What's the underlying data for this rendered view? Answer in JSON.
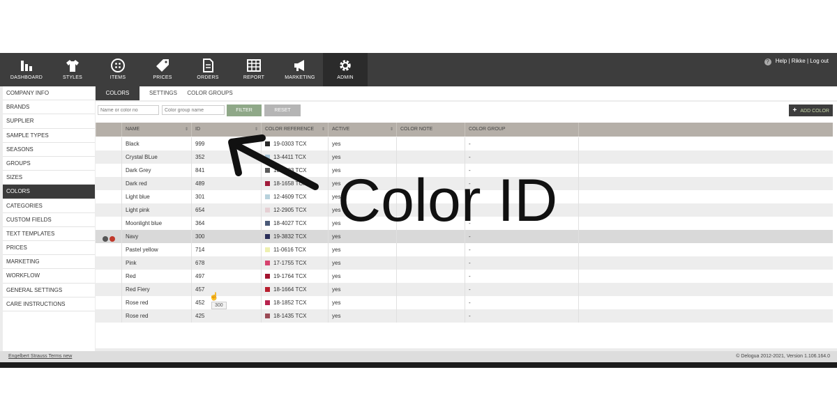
{
  "nav": {
    "items": [
      {
        "label": "DASHBOARD",
        "icon": "bar-chart-icon"
      },
      {
        "label": "STYLES",
        "icon": "shirt-icon"
      },
      {
        "label": "ITEMS",
        "icon": "button-icon"
      },
      {
        "label": "PRICES",
        "icon": "price-tag-icon"
      },
      {
        "label": "ORDERS",
        "icon": "document-icon"
      },
      {
        "label": "REPORT",
        "icon": "table-icon"
      },
      {
        "label": "MARKETING",
        "icon": "megaphone-icon"
      },
      {
        "label": "ADMIN",
        "icon": "gear-icon"
      }
    ],
    "help": "Help",
    "user": "Rikke",
    "logout": "Log out",
    "sep": "|"
  },
  "sidebar": {
    "items": [
      "COMPANY INFO",
      "BRANDS",
      "SUPPLIER",
      "SAMPLE TYPES",
      "SEASONS",
      "GROUPS",
      "SIZES",
      "COLORS",
      "CATEGORIES",
      "CUSTOM FIELDS",
      "TEXT TEMPLATES",
      "PRICES",
      "MARKETING",
      "WORKFLOW",
      "GENERAL SETTINGS",
      "CARE INSTRUCTIONS"
    ],
    "active": "COLORS"
  },
  "tabs": [
    "COLORS",
    "SETTINGS",
    "COLOR GROUPS"
  ],
  "filter": {
    "name_placeholder": "Name or color no",
    "group_placeholder": "Color group name",
    "filter_label": "FILTER",
    "reset_label": "RESET",
    "add_label": "ADD COLOR",
    "add_symbol": "+"
  },
  "table": {
    "headers": [
      "NAME",
      "ID",
      "COLOR REFERENCE",
      "ACTIVE",
      "COLOR NOTE",
      "COLOR GROUP"
    ],
    "sort_symbol": "⇕",
    "rows": [
      {
        "name": "Black",
        "id": "999",
        "ref": "19-0303 TCX",
        "swatch": "#2a2a2a",
        "active": "yes",
        "group": "-"
      },
      {
        "name": "Crystal BLue",
        "id": "352",
        "ref": "13-4411 TCX",
        "swatch": "#a9c6d8",
        "active": "yes",
        "group": "-"
      },
      {
        "name": "Dark Grey",
        "id": "841",
        "ref": "18-0403 TCX",
        "swatch": "#5a5a5a",
        "active": "yes",
        "group": "-"
      },
      {
        "name": "Dark red",
        "id": "489",
        "ref": "18-1658 TCX",
        "swatch": "#a01b3a",
        "active": "yes",
        "group": "-"
      },
      {
        "name": "Light blue",
        "id": "301",
        "ref": "12-4609 TCX",
        "swatch": "#b8d2dc",
        "active": "yes",
        "group": "-"
      },
      {
        "name": "Light pink",
        "id": "654",
        "ref": "12-2905 TCX",
        "swatch": "#e5cfd3",
        "active": "yes",
        "group": "-"
      },
      {
        "name": "Moonlight blue",
        "id": "364",
        "ref": "18-4027 TCX",
        "swatch": "#4a5a78",
        "active": "yes",
        "group": "-"
      },
      {
        "name": "Navy",
        "id": "300",
        "ref": "19-3832 TCX",
        "swatch": "#2b2f5a",
        "active": "yes",
        "group": "-"
      },
      {
        "name": "Pastel yellow",
        "id": "714",
        "ref": "11-0616 TCX",
        "swatch": "#eef0b0",
        "active": "yes",
        "group": "-"
      },
      {
        "name": "Pink",
        "id": "678",
        "ref": "17-1755 TCX",
        "swatch": "#d6426e",
        "active": "yes",
        "group": "-"
      },
      {
        "name": "Red",
        "id": "497",
        "ref": "19-1764 TCX",
        "swatch": "#a3142e",
        "active": "yes",
        "group": "-"
      },
      {
        "name": "Red Fiery",
        "id": "457",
        "ref": "18-1664 TCX",
        "swatch": "#b81e2e",
        "active": "yes",
        "group": "-"
      },
      {
        "name": "Rose red",
        "id": "452",
        "ref": "18-1852 TCX",
        "swatch": "#b8234e",
        "active": "yes",
        "group": "-"
      },
      {
        "name": "Rose red",
        "id": "425",
        "ref": "18-1435 TCX",
        "swatch": "#9a4a55",
        "active": "yes",
        "group": "-"
      }
    ],
    "hover_row": 7
  },
  "tooltip": "300",
  "footer": {
    "left": "Engelbert Strauss Terms new",
    "right": "© Delogua 2012-2021, Version 1.106.164.0"
  },
  "annotation": "Color ID",
  "colors": {
    "nav_bg": "#3d3d3d",
    "filter_btn": "#8fa888",
    "reset_btn": "#b5b5b5",
    "header_bg": "#b5afa8"
  }
}
